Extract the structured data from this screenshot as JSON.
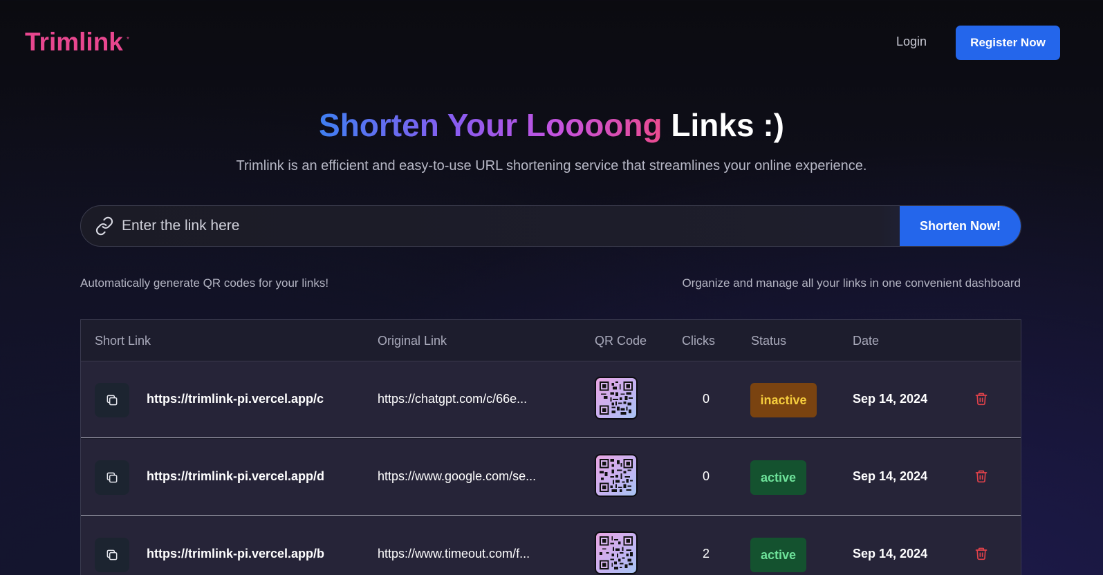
{
  "header": {
    "logo": "Trimlink",
    "logo_mark": "*",
    "login_label": "Login",
    "register_label": "Register Now"
  },
  "hero": {
    "title_gradient": "Shorten Your Loooong",
    "title_plain": "Links :)",
    "subtitle": "Trimlink is an efficient and easy-to-use URL shortening service that streamlines your online experience."
  },
  "search": {
    "placeholder": "Enter the link here",
    "value": "",
    "button_label": "Shorten Now!",
    "icon": "link-icon"
  },
  "features": {
    "left": "Automatically generate QR codes for your links!",
    "right": "Organize and manage all your links in one convenient dashboard"
  },
  "table": {
    "columns": [
      "Short Link",
      "Original Link",
      "QR Code",
      "Clicks",
      "Status",
      "Date"
    ],
    "rows": [
      {
        "short_link": "https://trimlink-pi.vercel.app/c",
        "original_link": "https://chatgpt.com/c/66e...",
        "clicks": "0",
        "status": "inactive",
        "date": "Sep 14, 2024"
      },
      {
        "short_link": "https://trimlink-pi.vercel.app/d",
        "original_link": "https://www.google.com/se...",
        "clicks": "0",
        "status": "active",
        "date": "Sep 14, 2024"
      },
      {
        "short_link": "https://trimlink-pi.vercel.app/b",
        "original_link": "https://www.timeout.com/f...",
        "clicks": "2",
        "status": "active",
        "date": "Sep 14, 2024"
      }
    ]
  },
  "colors": {
    "brand": "#e8478f",
    "primary_button": "#2466eb",
    "inactive_bg": "#7a4310",
    "inactive_text": "#f6cd3d",
    "active_bg": "#14522f",
    "active_text": "#6ee29a",
    "danger": "#e0414a"
  }
}
